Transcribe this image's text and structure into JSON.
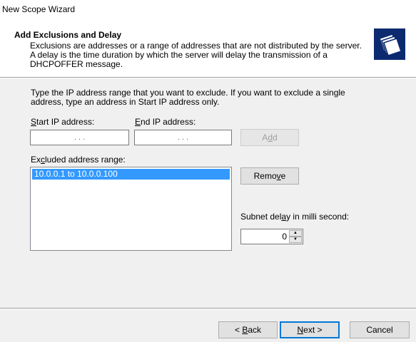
{
  "window": {
    "title": "New Scope Wizard"
  },
  "header": {
    "title": "Add Exclusions and Delay",
    "description": "Exclusions are addresses or a range of addresses that are not distributed by the server. A delay is the time duration by which the server will delay the transmission of a DHCPOFFER message.",
    "icon": "wizard-pages-icon"
  },
  "main": {
    "instructions": "Type the IP address range that you want to exclude. If you want to exclude a single address, type an address in Start IP address only.",
    "start_ip": {
      "label_pre": "",
      "label_key": "S",
      "label_post": "tart IP address:",
      "value": ". . ."
    },
    "end_ip": {
      "label_pre": "",
      "label_key": "E",
      "label_post": "nd IP address:",
      "value": ". . ."
    },
    "add_button": {
      "pre": "A",
      "key": "d",
      "post": "d"
    },
    "excluded_label": {
      "pre": "Ex",
      "key": "c",
      "post": "luded address range:"
    },
    "excluded_ranges": [
      "10.0.0.1 to 10.0.0.100"
    ],
    "remove_button": {
      "pre": "Remo",
      "key": "v",
      "post": "e"
    },
    "delay_label": {
      "pre": "Subnet del",
      "key": "a",
      "post": "y in milli second:"
    },
    "delay_value": "0"
  },
  "footer": {
    "back": {
      "pre": "< ",
      "key": "B",
      "post": "ack"
    },
    "next": {
      "pre": "",
      "key": "N",
      "post": "ext >"
    },
    "cancel": "Cancel"
  }
}
